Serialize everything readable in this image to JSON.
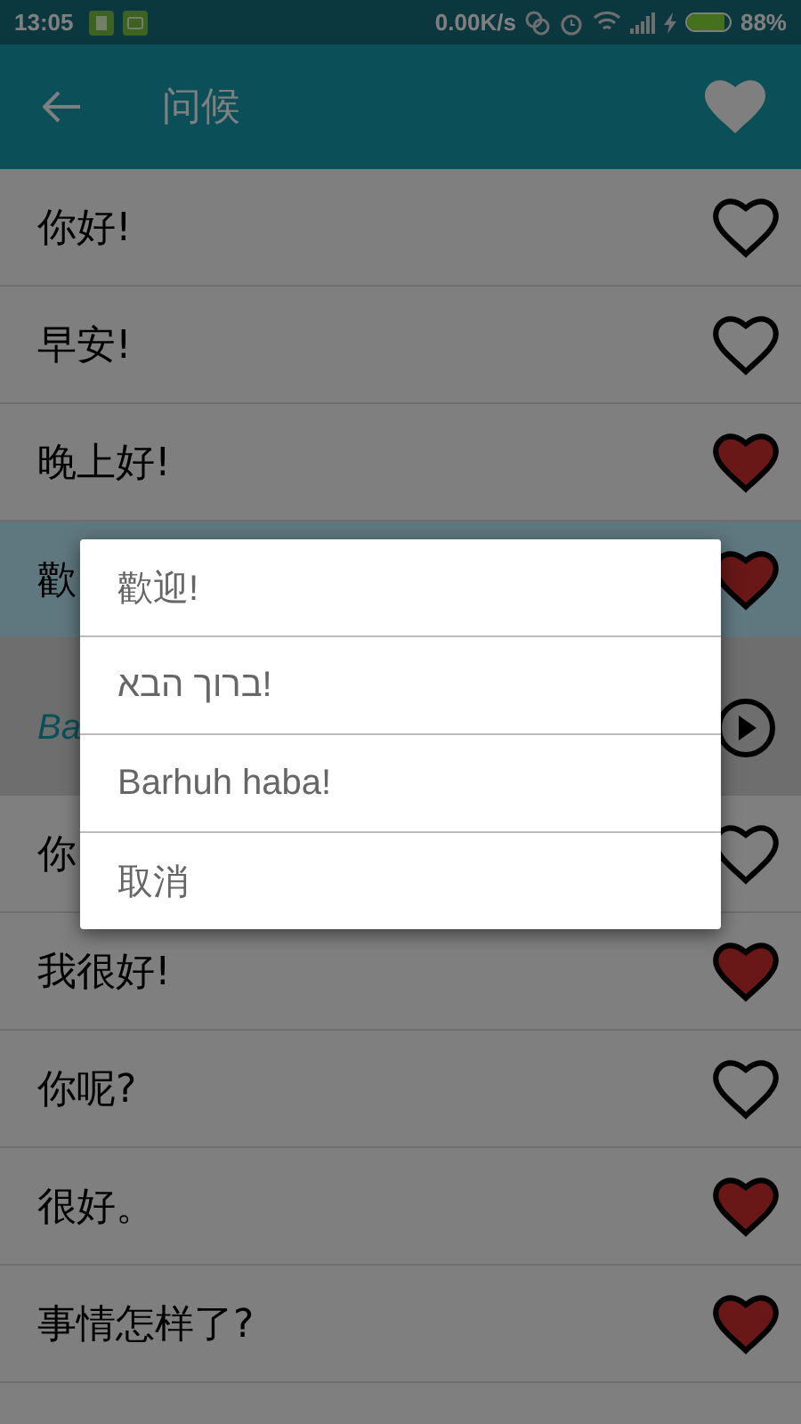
{
  "status_bar": {
    "time": "13:05",
    "speed": "0.00K/s",
    "battery": "88%"
  },
  "app_bar": {
    "title": "问候"
  },
  "rows": [
    {
      "kind": "phrase",
      "text": "你好!",
      "favorite": false,
      "selected": false
    },
    {
      "kind": "phrase",
      "text": "早安!",
      "favorite": false,
      "selected": false
    },
    {
      "kind": "phrase",
      "text": "晚上好!",
      "favorite": true,
      "selected": false
    },
    {
      "kind": "phrase",
      "text": "歡",
      "favorite": true,
      "selected": true
    },
    {
      "kind": "translation",
      "text": "Ba"
    },
    {
      "kind": "phrase",
      "text": "你",
      "favorite": false,
      "selected": false
    },
    {
      "kind": "phrase",
      "text": "我很好!",
      "favorite": true,
      "selected": false
    },
    {
      "kind": "phrase",
      "text": "你呢?",
      "favorite": false,
      "selected": false
    },
    {
      "kind": "phrase",
      "text": "很好。",
      "favorite": true,
      "selected": false
    },
    {
      "kind": "phrase",
      "text": "事情怎样了?",
      "favorite": true,
      "selected": false
    }
  ],
  "dialog": {
    "items": [
      "歡迎!",
      "ברוך הבא!",
      "Barhuh haba!",
      "取消"
    ]
  }
}
